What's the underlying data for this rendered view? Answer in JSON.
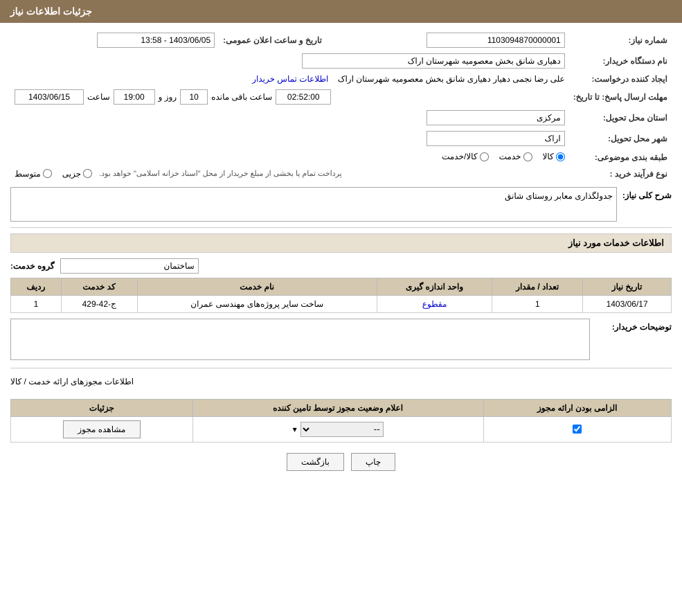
{
  "header": {
    "title": "جزئیات اطلاعات نیاز"
  },
  "fields": {
    "shomare_niaz_label": "شماره نیاز:",
    "shomare_niaz_value": "1103094870000001",
    "name_dastgah_label": "نام دستگاه خریدار:",
    "name_dastgah_value": "دهیاری شانق بخش معصومیه شهرستان اراک",
    "tarikh_elan_label": "تاریخ و ساعت اعلان عمومی:",
    "tarikh_elan_value": "1403/06/05 - 13:58",
    "ijad_label": "ایجاد کننده درخواست:",
    "ijad_value": "علی رضا نجمی دهیار دهیاری شانق بخش معصومیه شهرستان اراک",
    "etelaat_tamas": "اطلاعات تماس خریدار",
    "mohlat_label": "مهلت ارسال پاسخ: تا تاریخ:",
    "mohlat_date": "1403/06/15",
    "mohlat_saat_label": "ساعت",
    "mohlat_saat": "19:00",
    "mohlat_rooz_label": "روز و",
    "mohlat_rooz": "10",
    "mohlat_mande_label": "ساعت باقی مانده",
    "mohlat_mande": "02:52:00",
    "ostan_label": "استان محل تحویل:",
    "ostan_value": "مرکزی",
    "shahr_label": "شهر محل تحویل:",
    "shahr_value": "اراک",
    "tabaqeh_label": "طبقه بندی موضوعی:",
    "tabaqeh_options": [
      "کالا",
      "خدمت",
      "کالا/خدمت"
    ],
    "tabaqeh_selected": "کالا",
    "nooe_farayand_label": "نوع فرآیند خرید :",
    "nooe_farayand_options": [
      "جزیی",
      "متوسط"
    ],
    "nooe_farayand_note": "پرداخت تمام یا بخشی از مبلغ خریدار از محل \"اسناد خزانه اسلامی\" خواهد بود.",
    "sharh_label": "شرح کلی نیاز:",
    "sharh_value": "جدولگذاری معابر روستای شانق",
    "services_title": "اطلاعات خدمات مورد نیاز",
    "gorooh_label": "گروه خدمت:",
    "gorooh_value": "ساختمان",
    "table_headers": {
      "radif": "ردیف",
      "kod_khedmat": "کد خدمت",
      "name_khedmat": "نام خدمت",
      "vahed": "واحد اندازه گیری",
      "tedad": "تعداد / مقدار",
      "tarikh": "تاریخ نیاز"
    },
    "table_rows": [
      {
        "radif": "1",
        "kod": "ج-42-429",
        "name": "ساخت سایر پروژه‌های مهندسی عمران",
        "vahed": "مقطوع",
        "tedad": "1",
        "tarikh": "1403/06/17"
      }
    ],
    "tosih_label": "توضیحات خریدار:",
    "majoz_title": "اطلاعات مجوزهای ارائه خدمت / کالا",
    "majoz_table_headers": {
      "elzami": "الزامی بودن ارائه مجوز",
      "eelam": "اعلام وضعیت مجوز توسط تامین کننده",
      "joziyat": "جزئیات"
    },
    "majoz_rows": [
      {
        "elzami": true,
        "eelam": "--",
        "joziyat_btn": "مشاهده مجوز"
      }
    ],
    "btn_chap": "چاپ",
    "btn_bazgasht": "بازگشت"
  }
}
